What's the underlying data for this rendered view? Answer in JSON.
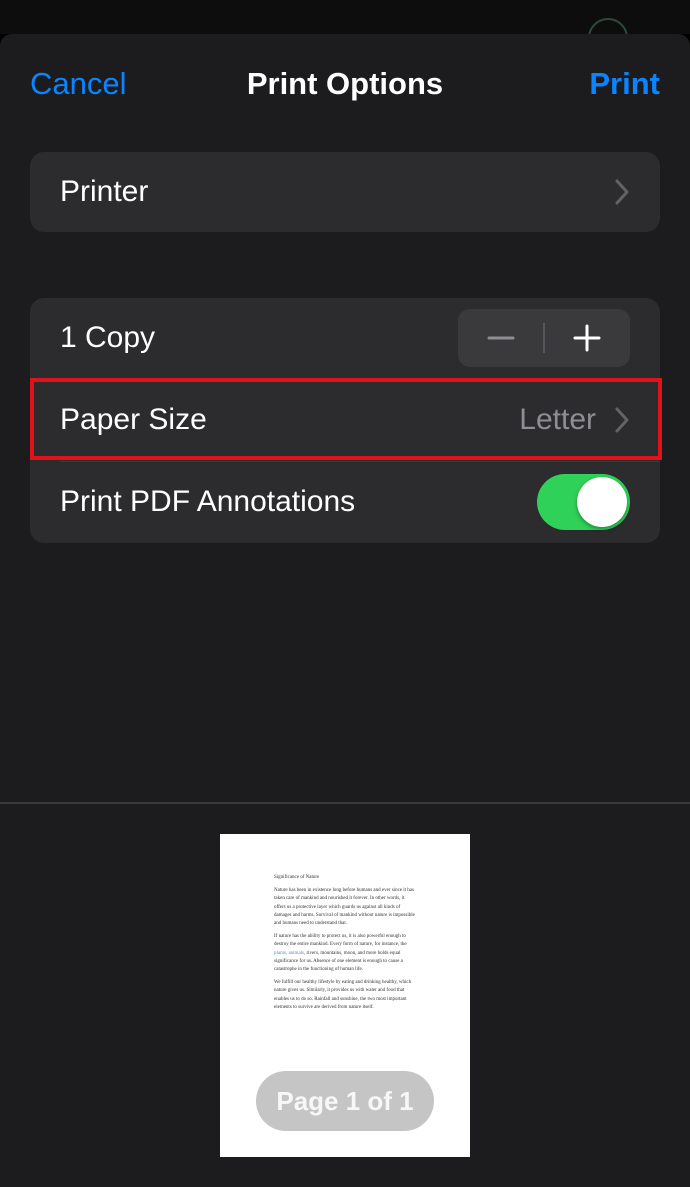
{
  "nav": {
    "cancel_label": "Cancel",
    "title": "Print Options",
    "print_label": "Print"
  },
  "printer": {
    "label": "Printer"
  },
  "options": {
    "copies_label": "1 Copy",
    "copies_count": 1,
    "paper_size_label": "Paper Size",
    "paper_size_value": "Letter",
    "annotations_label": "Print PDF Annotations",
    "annotations_enabled": true
  },
  "icons": {
    "stepper_decrement": "minus-icon",
    "stepper_increment": "plus-icon",
    "disclosure": "chevron-right-icon"
  },
  "colors": {
    "accent": "#0a84ff",
    "toggle_on": "#30d158",
    "highlight_border": "#e0121a",
    "sheet_background": "#1c1c1e",
    "group_background": "#2c2c2e"
  },
  "preview": {
    "document": {
      "title": "Significance of Nature",
      "paragraph_1": "Nature has been in existence long before humans and ever since it has taken care of mankind and nourished it forever. In other words, it offers us a protective layer which guards us against all kinds of damages and harms. Survival of mankind without nature is impossible and humans need to understand that.",
      "paragraph_2_start": "If nature has the ability to protect us, it is also powerful enough to destroy the entire mankind. Every form of nature, for instance, the ",
      "paragraph_2_link": "plants, animals",
      "paragraph_2_end": ", rivers, mountains, moon, and more holds equal significance for us. Absence of one element is enough to cause a catastrophe in the functioning of human life.",
      "paragraph_3": "We fulfill our healthy lifestyle by eating and drinking healthy, which nature gives us. Similarly, it provides us with water and food that enables us to do so. Rainfall and sunshine, the two most important elements to survive are derived from nature itself."
    },
    "page_indicator": "Page 1 of 1"
  }
}
